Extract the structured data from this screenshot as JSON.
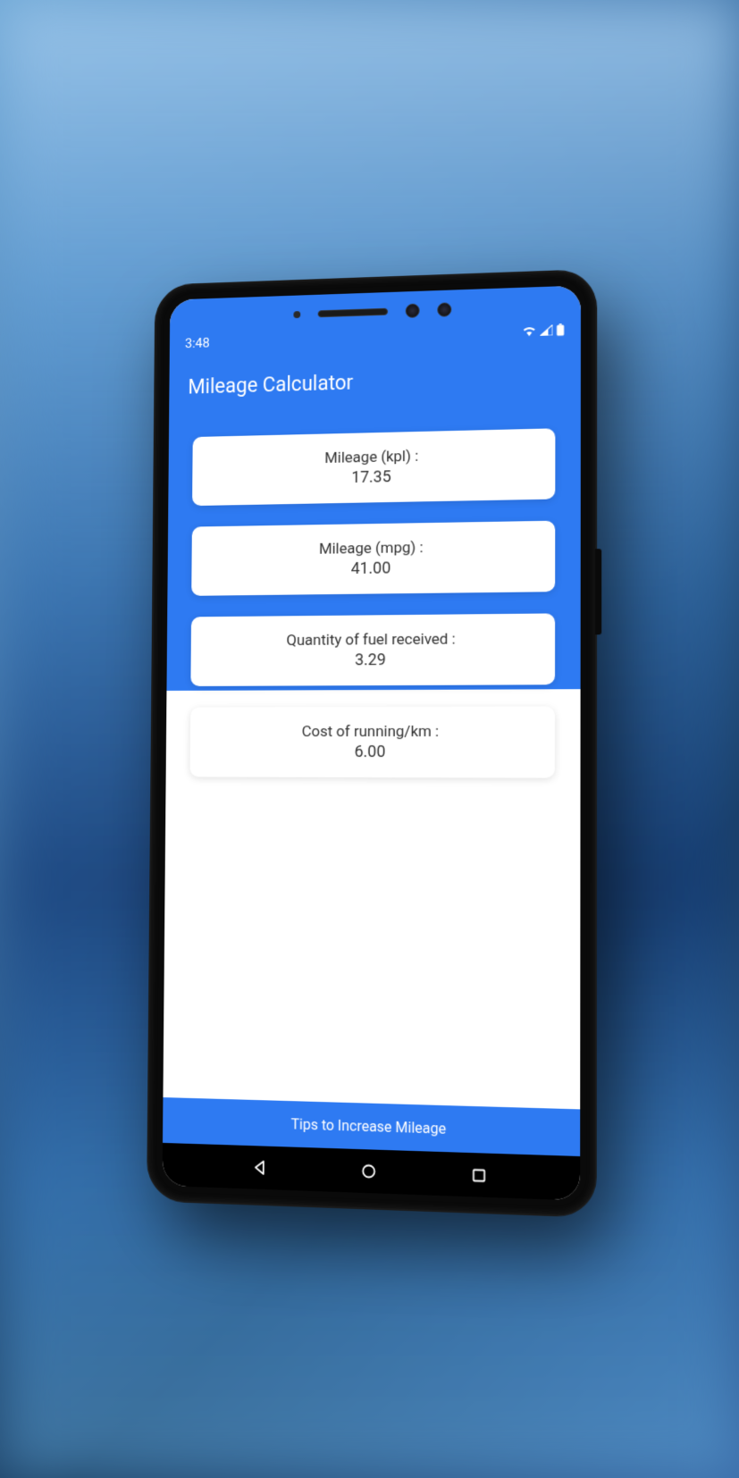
{
  "status_bar": {
    "time": "3:48"
  },
  "header": {
    "title": "Mileage Calculator"
  },
  "results": [
    {
      "label": "Mileage (kpl) :",
      "value": "17.35"
    },
    {
      "label": "Mileage (mpg) :",
      "value": "41.00"
    },
    {
      "label": "Quantity of fuel received :",
      "value": "3.29"
    },
    {
      "label": "Cost of running/km :",
      "value": "6.00"
    }
  ],
  "footer": {
    "tips_button": "Tips to Increase Mileage"
  }
}
